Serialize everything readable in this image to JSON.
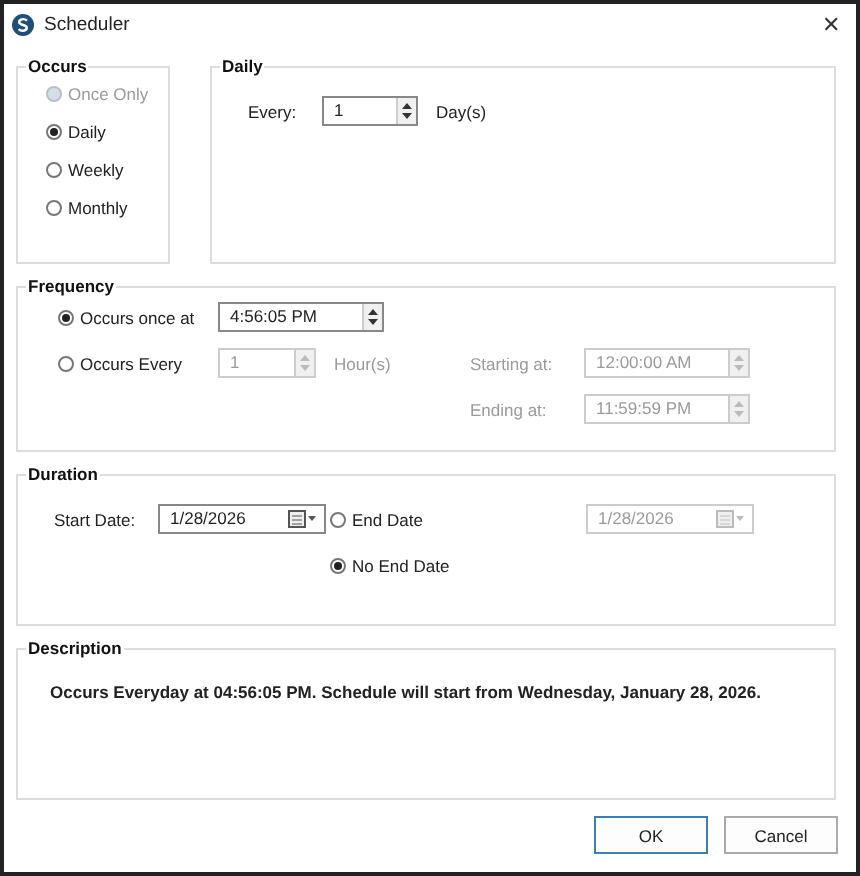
{
  "window": {
    "title": "Scheduler",
    "close": "✕"
  },
  "occurs": {
    "title": "Occurs",
    "options": [
      {
        "label": "Once Only",
        "selected": false,
        "disabled": true
      },
      {
        "label": "Daily",
        "selected": true,
        "disabled": false
      },
      {
        "label": "Weekly",
        "selected": false,
        "disabled": false
      },
      {
        "label": "Monthly",
        "selected": false,
        "disabled": false
      }
    ]
  },
  "daily": {
    "title": "Daily",
    "every_label": "Every:",
    "every_value": "1",
    "unit": "Day(s)"
  },
  "frequency": {
    "title": "Frequency",
    "once": {
      "label": "Occurs once at",
      "selected": true,
      "value": "4:56:05 PM"
    },
    "every": {
      "label": "Occurs Every",
      "selected": false,
      "value": "1",
      "unit": "Hour(s)",
      "disabled": true
    },
    "starting_label": "Starting at:",
    "starting_value": "12:00:00 AM",
    "ending_label": "Ending at:",
    "ending_value": "11:59:59 PM",
    "range_disabled": true
  },
  "duration": {
    "title": "Duration",
    "start_label": "Start Date:",
    "start_value": "1/28/2026",
    "end_date": {
      "label": "End Date",
      "selected": false,
      "value": "1/28/2026",
      "disabled": true
    },
    "no_end": {
      "label": "No End Date",
      "selected": true
    }
  },
  "description": {
    "title": "Description",
    "text": "Occurs Everyday at 04:56:05 PM. Schedule will start from Wednesday, January 28, 2026."
  },
  "buttons": [
    {
      "label": "OK",
      "default": true
    },
    {
      "label": "Cancel",
      "default": false
    }
  ]
}
